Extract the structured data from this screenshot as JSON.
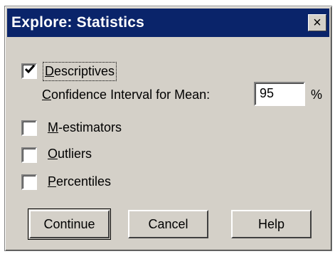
{
  "dialog": {
    "title": "Explore: Statistics",
    "close_glyph": "×"
  },
  "options": {
    "descriptives": {
      "mnemonic": "D",
      "rest": "escriptives",
      "checked": true
    },
    "ci": {
      "mnemonic": "C",
      "rest": "onfidence Interval for Mean:",
      "value": "95",
      "unit": "%"
    },
    "m_estimators": {
      "mnemonic": "M",
      "rest": "-estimators",
      "checked": false
    },
    "outliers": {
      "mnemonic": "O",
      "rest": "utliers",
      "checked": false
    },
    "percentiles": {
      "mnemonic": "P",
      "rest": "ercentiles",
      "checked": false
    }
  },
  "buttons": {
    "continue": "Continue",
    "cancel": "Cancel",
    "help": "Help"
  },
  "icons": {
    "close": "close-icon",
    "check": "check-icon"
  },
  "colors": {
    "titlebar": "#0a246a",
    "face": "#d4d0c8"
  }
}
